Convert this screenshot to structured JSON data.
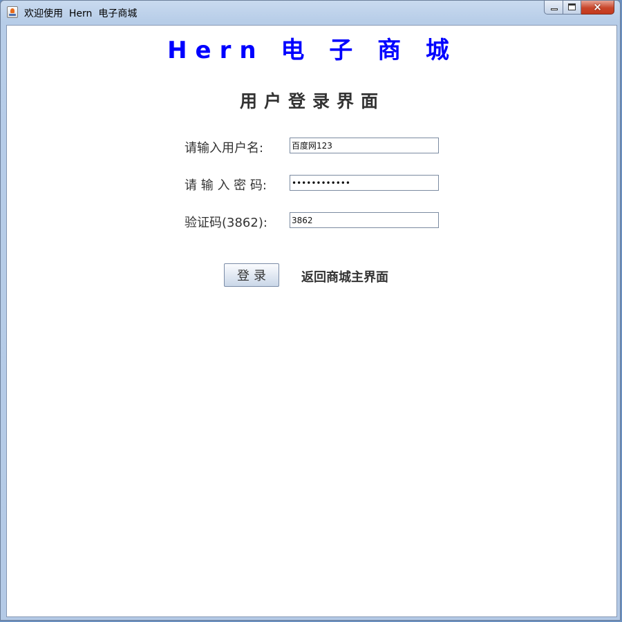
{
  "window": {
    "title": "欢迎使用  Hern  电子商城",
    "icon": "java-cup-icon",
    "controls": {
      "minimize": "minimize-icon",
      "maximize": "maximize-icon",
      "close": "×"
    }
  },
  "header": {
    "store_title": "Hern 电 子 商 城",
    "page_heading": "用户登录界面"
  },
  "form": {
    "username": {
      "label": "请输入用户名:",
      "value": "百度网123"
    },
    "password": {
      "label": "请 输 入 密 码:",
      "value": "ffffffffffff"
    },
    "captcha": {
      "label": "验证码(3862):",
      "value": "3862"
    }
  },
  "actions": {
    "login_label": "登录",
    "back_label": "返回商城主界面"
  },
  "colors": {
    "title_blue": "#0000ff",
    "text_dark": "#333333"
  }
}
